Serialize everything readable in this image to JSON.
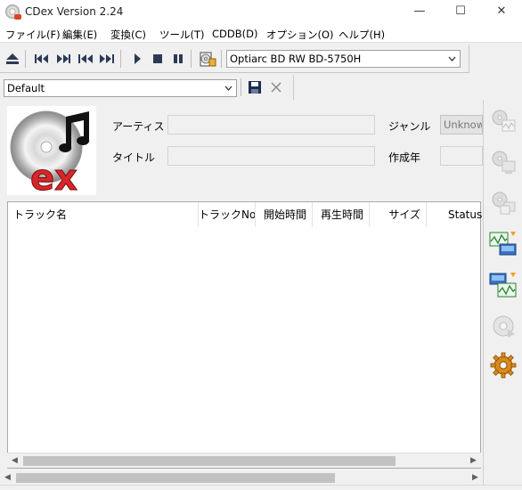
{
  "window": {
    "title": "CDex Version 2.24",
    "min_glyph": "—",
    "max_glyph": "☐",
    "close_glyph": "✕"
  },
  "menu": [
    {
      "label": "ファイル(F)"
    },
    {
      "label": "編集(E)"
    },
    {
      "label": "変換(C)"
    },
    {
      "label": "ツール(T)"
    },
    {
      "label": "CDDB(D)"
    },
    {
      "label": "オプション(O)"
    },
    {
      "label": "ヘルプ(H)"
    }
  ],
  "toolbar": {
    "icons": [
      "eject-icon",
      "rewind-icon",
      "fast-forward-icon",
      "previous-track-icon",
      "next-track-icon",
      "play-icon",
      "stop-icon",
      "pause-icon",
      "cd-info-icon"
    ],
    "drive": "Optiarc BD RW BD-5750H"
  },
  "profile": {
    "value": "Default"
  },
  "info": {
    "artist_label": "アーティスト",
    "title_label": "タイトル",
    "genre_label": "ジャンル",
    "year_label": "作成年",
    "genre_value": "Unknown"
  },
  "tracks": {
    "columns": [
      "トラック名",
      "トラックNo",
      "開始時間",
      "再生時間",
      "サイズ",
      "Status"
    ],
    "rows": []
  },
  "side_buttons": [
    "extract-wav-icon",
    "extract-mp3-icon",
    "copy-tracks-icon",
    "wav-to-mp3-icon",
    "mp3-to-wav-icon",
    "play-file-icon",
    "settings-gear-icon"
  ],
  "colors": {
    "gear": "#d98a1c",
    "logo_red": "#d8262a"
  }
}
